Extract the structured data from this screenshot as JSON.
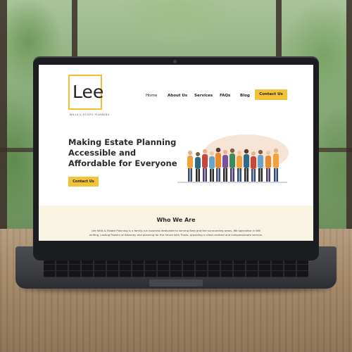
{
  "website": {
    "logo": {
      "name": "Lee",
      "tagline": "WILLS & ESTATE PLANNING"
    },
    "nav": {
      "items": [
        "Home",
        "About Us",
        "Services",
        "FAQs",
        "Blog"
      ],
      "cta": "Contact Us"
    },
    "hero": {
      "title": "Making Estate Planning Accessible and Affordable for Everyone",
      "button": "Contact Us"
    },
    "who": {
      "title": "Who We Are",
      "text": "Lee Wills & Estate Planning is a family-run business dedicated to serving Kent and the surrounding areas. We specialise in Will writing, Lasting Powers of Attorney and planning for the future with Trusts, providing a client-centred and compassionate service."
    }
  },
  "colors": {
    "accent": "#f4c236",
    "section_bg": "#f8f3e2",
    "laptop": "#1c1d20"
  }
}
